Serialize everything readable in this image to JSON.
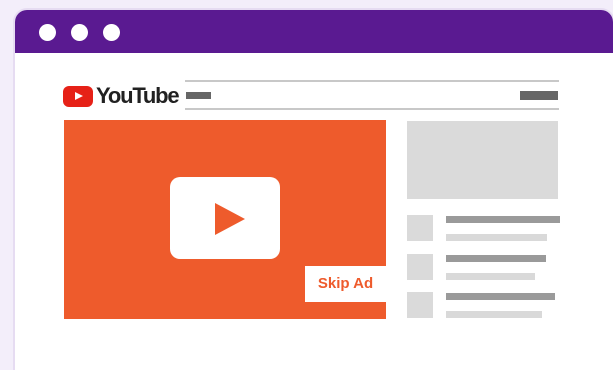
{
  "app": {
    "logo_text": "YouTube"
  },
  "player": {
    "skip_label": "Skip Ad"
  },
  "colors": {
    "titlebar": "#5a1a91",
    "player": "#ee5b2c",
    "logo_red": "#e62117"
  },
  "icons": {
    "window_controls": [
      "window-dot-icon",
      "window-dot-icon",
      "window-dot-icon"
    ],
    "logo": "youtube-play-icon",
    "player": "play-icon"
  }
}
